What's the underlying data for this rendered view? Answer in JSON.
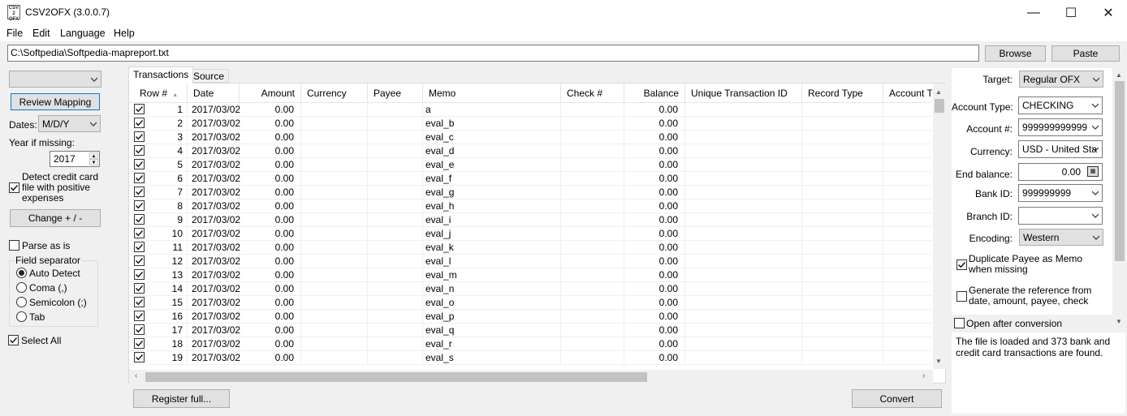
{
  "window": {
    "title": "CSV2OFX (3.0.0.7)",
    "icon_text": "CSV\n2\nOFX",
    "minimize_glyph": "—",
    "maximize_glyph": "☐",
    "close_glyph": "✕"
  },
  "menu": [
    "File",
    "Edit",
    "Language",
    "Help"
  ],
  "path": {
    "value": "C:\\Softpedia\\Softpedia-mapreport.txt",
    "browse_label": "Browse",
    "paste_label": "Paste"
  },
  "left": {
    "mapping_select": "",
    "review_mapping_label": "Review Mapping",
    "dates_label": "Dates:",
    "dates_value": "M/D/Y",
    "year_label": "Year if missing:",
    "year_value": "2017",
    "detect_credit_label": "Detect credit card file with positive expenses",
    "detect_credit_checked": true,
    "change_label": "Change + / -",
    "parse_as_is_label": "Parse as is",
    "parse_as_is_checked": false,
    "field_sep_title": "Field separator",
    "separators": [
      "Auto Detect",
      "Coma (,)",
      "Semicolon (;)",
      "Tab"
    ],
    "separator_selected": 0,
    "select_all_label": "Select All",
    "select_all_checked": true
  },
  "tabs": [
    "Transactions",
    "Source"
  ],
  "grid": {
    "columns": [
      "Row #",
      "Date",
      "Amount",
      "Currency",
      "Payee",
      "Memo",
      "Check #",
      "Balance",
      "Unique Transaction ID",
      "Record Type",
      "Account Ty"
    ],
    "rows": [
      {
        "n": "1",
        "date": "2017/03/02",
        "amount": "0.00",
        "memo": "a",
        "balance": "0.00"
      },
      {
        "n": "2",
        "date": "2017/03/02",
        "amount": "0.00",
        "memo": "eval_b",
        "balance": "0.00"
      },
      {
        "n": "3",
        "date": "2017/03/02",
        "amount": "0.00",
        "memo": "eval_c",
        "balance": "0.00"
      },
      {
        "n": "4",
        "date": "2017/03/02",
        "amount": "0.00",
        "memo": "eval_d",
        "balance": "0.00"
      },
      {
        "n": "5",
        "date": "2017/03/02",
        "amount": "0.00",
        "memo": "eval_e",
        "balance": "0.00"
      },
      {
        "n": "6",
        "date": "2017/03/02",
        "amount": "0.00",
        "memo": "eval_f",
        "balance": "0.00"
      },
      {
        "n": "7",
        "date": "2017/03/02",
        "amount": "0.00",
        "memo": "eval_g",
        "balance": "0.00"
      },
      {
        "n": "8",
        "date": "2017/03/02",
        "amount": "0.00",
        "memo": "eval_h",
        "balance": "0.00"
      },
      {
        "n": "9",
        "date": "2017/03/02",
        "amount": "0.00",
        "memo": "eval_i",
        "balance": "0.00"
      },
      {
        "n": "10",
        "date": "2017/03/02",
        "amount": "0.00",
        "memo": "eval_j",
        "balance": "0.00"
      },
      {
        "n": "11",
        "date": "2017/03/02",
        "amount": "0.00",
        "memo": "eval_k",
        "balance": "0.00"
      },
      {
        "n": "12",
        "date": "2017/03/02",
        "amount": "0.00",
        "memo": "eval_l",
        "balance": "0.00"
      },
      {
        "n": "13",
        "date": "2017/03/02",
        "amount": "0.00",
        "memo": "eval_m",
        "balance": "0.00"
      },
      {
        "n": "14",
        "date": "2017/03/02",
        "amount": "0.00",
        "memo": "eval_n",
        "balance": "0.00"
      },
      {
        "n": "15",
        "date": "2017/03/02",
        "amount": "0.00",
        "memo": "eval_o",
        "balance": "0.00"
      },
      {
        "n": "16",
        "date": "2017/03/02",
        "amount": "0.00",
        "memo": "eval_p",
        "balance": "0.00"
      },
      {
        "n": "17",
        "date": "2017/03/02",
        "amount": "0.00",
        "memo": "eval_q",
        "balance": "0.00"
      },
      {
        "n": "18",
        "date": "2017/03/02",
        "amount": "0.00",
        "memo": "eval_r",
        "balance": "0.00"
      },
      {
        "n": "19",
        "date": "2017/03/02",
        "amount": "0.00",
        "memo": "eval_s",
        "balance": "0.00"
      }
    ]
  },
  "bottom": {
    "register_label": "Register full...",
    "convert_label": "Convert"
  },
  "right": {
    "target_label": "Target:",
    "target_value": "Regular OFX",
    "account_type_label": "Account Type:",
    "account_type_value": "CHECKING",
    "account_no_label": "Account #:",
    "account_no_value": "999999999999",
    "currency_label": "Currency:",
    "currency_value": "USD - United Sta",
    "end_balance_label": "End balance:",
    "end_balance_value": "0.00",
    "bank_id_label": "Bank ID:",
    "bank_id_value": "999999999",
    "branch_id_label": "Branch ID:",
    "branch_id_value": "",
    "encoding_label": "Encoding:",
    "encoding_value": "Western",
    "dup_payee_label": "Duplicate Payee as Memo when missing",
    "dup_payee_checked": true,
    "gen_ref_label": "Generate the reference from date, amount, payee, check",
    "gen_ref_checked": false,
    "open_after_label": "Open after conversion",
    "open_after_checked": false,
    "status": "The file is loaded and 373 bank and credit card transactions are found."
  }
}
